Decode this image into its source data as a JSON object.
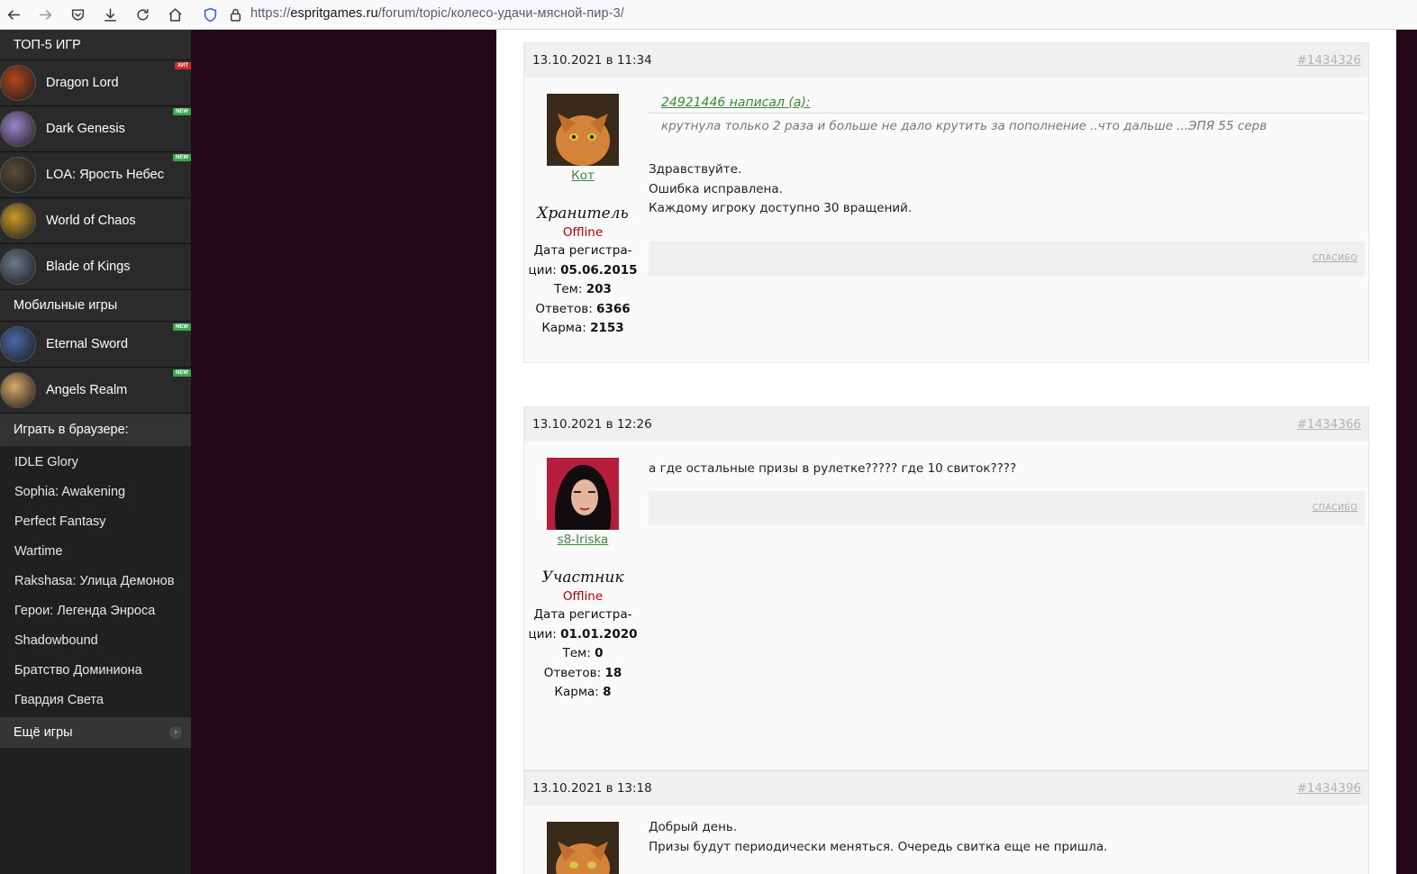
{
  "browser": {
    "url_prefix": "https://",
    "url_host": "espritgames.ru",
    "url_path": "/forum/topic/колесо-удачи-мясной-пир-3/"
  },
  "sidebar": {
    "top_title": "ТОП-5 ИГР",
    "top_games": [
      {
        "name": "Dragon Lord",
        "badge": "ХИТ",
        "icon": "dragon-lord-icon",
        "color": "#b3461c"
      },
      {
        "name": "Dark Genesis",
        "badge": "NEW",
        "icon": "dark-genesis-icon",
        "color": "#9c86c9"
      },
      {
        "name": "LOA: Ярость Небес",
        "badge": "NEW",
        "icon": "loa-icon",
        "color": "#5a4a3a"
      },
      {
        "name": "World of Chaos",
        "badge": "",
        "icon": "world-of-chaos-icon",
        "color": "#c99a2a"
      },
      {
        "name": "Blade of Kings",
        "badge": "",
        "icon": "blade-of-kings-icon",
        "color": "#6a7a8a"
      }
    ],
    "mobile_title": "Мобильные игры",
    "mobile_games": [
      {
        "name": "Eternal Sword",
        "badge": "NEW",
        "icon": "eternal-sword-icon",
        "color": "#4a6aa8"
      },
      {
        "name": "Angels Realm",
        "badge": "NEW",
        "icon": "angels-realm-icon",
        "color": "#d9a86a"
      }
    ],
    "browser_title": "Играть в браузере:",
    "browser_games": [
      "IDLE Glory",
      "Sophia: Awakening",
      "Perfect Fantasy",
      "Wartime",
      "Rakshasa: Улица Демонов",
      "Герои: Легенда Энроса",
      "Shadowbound",
      "Братство Доминиона",
      "Гвардия Света"
    ],
    "more_label": "Ещё игры"
  },
  "posts": [
    {
      "date": "13.10.2021 в 11:34",
      "id": "#1434326",
      "author": "Кот",
      "rank": "Хранитель",
      "status": "Offline",
      "reg_label": "Дата регистра-",
      "reg_label2": "ции:",
      "reg_date": "05.06.2015",
      "topics_label": "Тем:",
      "topics": "203",
      "replies_label": "Ответов:",
      "replies": "6366",
      "karma_label": "Карма:",
      "karma": "2153",
      "quote_author": "24921446 написал (а):",
      "quote_text": "крутнула только 2 раза и больше не дало крутить за пополнение ..что дальше ...ЭПЯ 55 серв",
      "lines": [
        "Здравствуйте.",
        "Ошибка исправлена.",
        "Каждому игроку доступно 30 вращений."
      ],
      "thanks": "СПАСИБО"
    },
    {
      "date": "13.10.2021 в 12:26",
      "id": "#1434366",
      "author": "s8-Iriska",
      "rank": "Участник",
      "status": "Offline",
      "reg_label": "Дата регистра-",
      "reg_label2": "ции:",
      "reg_date": "01.01.2020",
      "topics_label": "Тем:",
      "topics": "0",
      "replies_label": "Ответов:",
      "replies": "18",
      "karma_label": "Карма:",
      "karma": "8",
      "lines": [
        "а где остальные призы в рулетке????? где 10 свиток????"
      ],
      "thanks": "СПАСИБО"
    },
    {
      "date": "13.10.2021 в 13:18",
      "id": "#1434396",
      "lines": [
        "Добрый день.",
        "Призы будут периодически меняться. Очередь свитка еще не пришла."
      ]
    }
  ],
  "colors": {
    "page_bg": "#250816",
    "sidebar_bg": "#202020",
    "link_green": "#3a8a3a",
    "offline_red": "#b00000",
    "badge_hit": "#d6272f",
    "badge_new": "#3aa94e"
  }
}
